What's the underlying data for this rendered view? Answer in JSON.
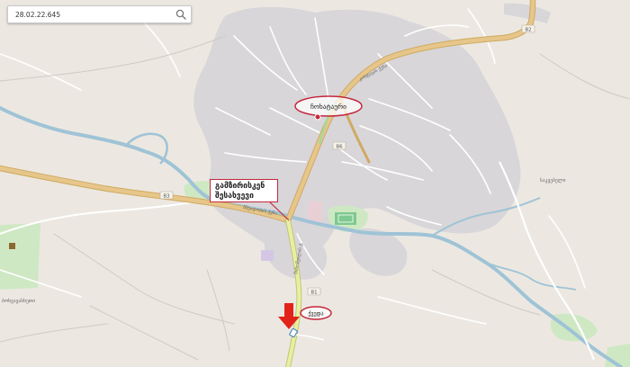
{
  "search": {
    "value": "28.02.22.645"
  },
  "labels": {
    "town": "ჩოხატაური",
    "destination": "ქვედა",
    "callout_line1": "გამზირისკენ",
    "callout_line2": "შესახვევი",
    "road_b3": "B3",
    "road_b1": "B1",
    "road_b6": "B6",
    "road_b2": "B2",
    "street_1": "მშვიდობის ქუჩა",
    "street_2": "კოსტავას ქუჩა",
    "street_3": "ნინოშვილის ქ.",
    "village_right": "საკვებელი",
    "village_left": "ბოხვავასხეთი"
  },
  "colors": {
    "land": "#ece8e1",
    "urban": "#d8d6d9",
    "river": "#9fc3d6",
    "main_road": "#e6c68a",
    "main_road_outline": "#d0aa62",
    "highlight_road": "#e9efa0",
    "park": "#cfe8c4",
    "annotation": "#c4283d",
    "arrow": "#e2231a"
  },
  "icons": [
    "search-icon",
    "arrow-down-icon",
    "town-marker-icon"
  ]
}
